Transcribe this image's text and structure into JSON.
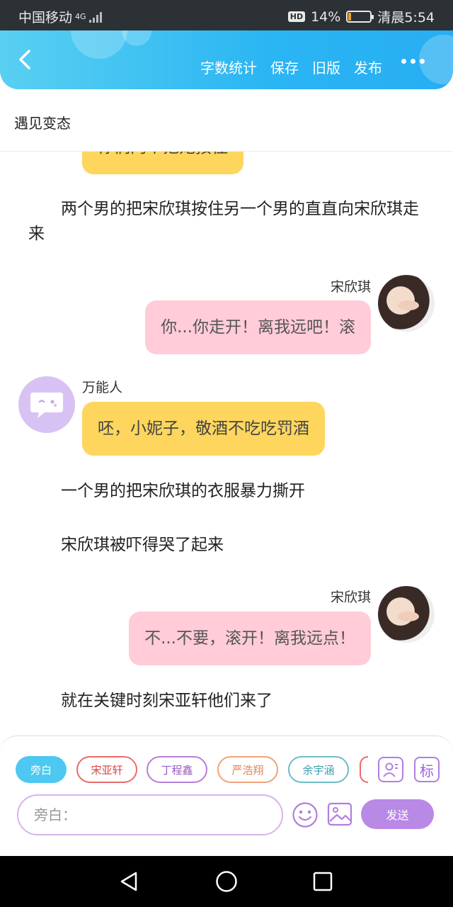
{
  "status_bar": {
    "carrier": "中国移动",
    "network": "4G",
    "hd": "HD",
    "battery_percent": "14%",
    "battery_level": 0.14,
    "time": "清晨5:54"
  },
  "header": {
    "actions": [
      "字数统计",
      "保存",
      "旧版",
      "发布"
    ]
  },
  "story": {
    "title": "遇见变态"
  },
  "messages": {
    "top_partial": "你们两个把她按住",
    "narration1": "两个男的把宋欣琪按住另一个男的直直向宋欣琪走来",
    "speaker1": "宋欣琪",
    "bubble1": "你...你走开！离我远吧！滚",
    "speaker2": "万能人",
    "bubble2": "呸，小妮子，敬酒不吃吃罚酒",
    "narration2": "一个男的把宋欣琪的衣服暴力撕开",
    "narration3": "宋欣琪被吓得哭了起来",
    "speaker3": "宋欣琪",
    "bubble3": "不...不要，滚开！离我远点！",
    "narration4": "就在关键时刻宋亚轩他们来了"
  },
  "compose": {
    "roles": [
      "旁白",
      "宋亚轩",
      "丁程鑫",
      "严浩翔",
      "余宇涵"
    ],
    "tag_button": "标",
    "input_placeholder": "旁白：",
    "send_label": "发送"
  },
  "colors": {
    "header_blue": "#2ab5f3",
    "bubble_pink": "#ffccd8",
    "bubble_yellow": "#fed65e",
    "send_purple": "#b989e6"
  }
}
